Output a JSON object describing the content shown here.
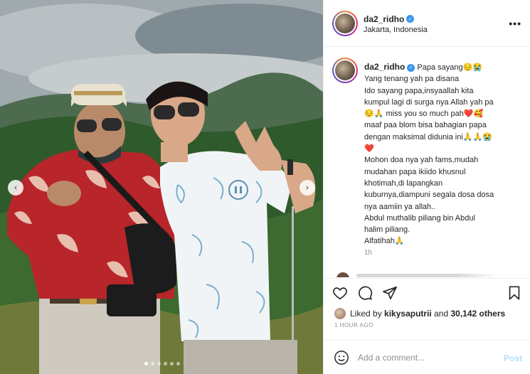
{
  "post": {
    "username": "da2_ridho",
    "verified_glyph": "✓",
    "location": "Jakarta, Indonesia",
    "more_glyph": "•••"
  },
  "media": {
    "prev_glyph": "‹",
    "next_glyph": "›",
    "carousel_slides": 6,
    "current_slide": 1
  },
  "caption": {
    "username": "da2_ridho",
    "lines": [
      "Papa sayang😔😭",
      "Yang tenang yah pa disana",
      "Ido sayang papa,insyaallah kita",
      "kumpul lagi di surga nya Allah yah pa",
      "😔🙏 miss you so much pah❤️🥰",
      "maaf paa blom bisa bahagian papa",
      "dengan maksimal didunia ini🙏🙏😭",
      "❤️",
      "Mohon doa nya yah fams,mudah",
      "mudahan papa ikiido khusnul",
      "khotimah,di lapangkan",
      "kuburnya,diampuni segala dosa dosa",
      "nya aamiin ya allah..",
      "Abdul muthalib piliang bin Abdul",
      "halim piliang.",
      "Alfatihah🙏"
    ],
    "time_ago": "1h"
  },
  "likes": {
    "prefix": "Liked by",
    "user": "kikysaputrii",
    "middle": "and",
    "count": "30,142 others"
  },
  "post_time": "1 HOUR AGO",
  "comment_box": {
    "placeholder": "Add a comment...",
    "post_label": "Post"
  },
  "icons": {
    "heart": "heart-icon",
    "comment": "comment-icon",
    "share": "share-icon",
    "save": "bookmark-icon",
    "emoji": "smiley-icon",
    "pause": "pause-icon"
  },
  "colors": {
    "verified": "#3897f0",
    "post_button": "#b2dffc",
    "shirt_red": "#b8252a",
    "ring_gradient": [
      "#f58529",
      "#dd2a7b",
      "#8134af",
      "#515bd4"
    ]
  }
}
